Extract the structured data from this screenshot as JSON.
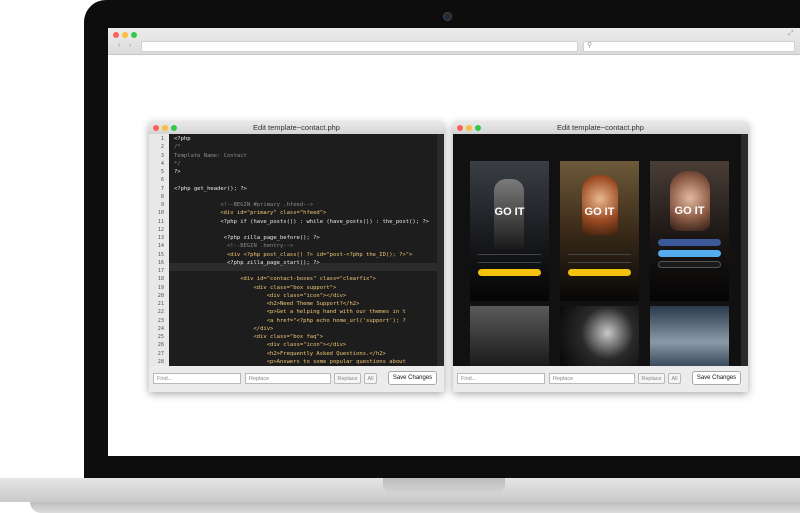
{
  "left_window": {
    "title": "Edit template~contact.php",
    "find_placeholder": "Find...",
    "replace_placeholder": "Replace",
    "replace_button": "Replace",
    "all_button": "All",
    "save_button": "Save Changes",
    "code_lines": [
      {
        "n": "1",
        "text": "<?php"
      },
      {
        "n": "2",
        "text": "/*"
      },
      {
        "n": "3",
        "text": "Template Name: Contact"
      },
      {
        "n": "4",
        "text": "*/"
      },
      {
        "n": "5",
        "text": "?>"
      },
      {
        "n": "6",
        "text": ""
      },
      {
        "n": "7",
        "text": "<?php get_header(); ?>"
      },
      {
        "n": "8",
        "text": ""
      },
      {
        "n": "9",
        "text": "              <!--BEGIN #primary .hfeed-->"
      },
      {
        "n": "10",
        "text": "              <div id=\"primary\" class=\"hfeed\">"
      },
      {
        "n": "11",
        "text": "              <?php if (have_posts()) : while (have_posts()) : the_post(); ?>"
      },
      {
        "n": "12",
        "text": ""
      },
      {
        "n": "13",
        "text": "               <?php zilla_page_before(); ?>"
      },
      {
        "n": "14",
        "text": "                <!--BEGIN .hentry-->"
      },
      {
        "n": "15",
        "text": "                <div <?php post_class() ?> id=\"post-<?php the_ID(); ?>\">"
      },
      {
        "n": "16",
        "text": "                <?php zilla_page_start(); ?>"
      },
      {
        "n": "17",
        "text": ""
      },
      {
        "n": "18",
        "text": "                    <div id=\"contact-boxes\" class=\"clearfix\">"
      },
      {
        "n": "19",
        "text": "                        <div class=\"box support\">"
      },
      {
        "n": "20",
        "text": "                            <div class=\"icon\"></div>"
      },
      {
        "n": "21",
        "text": "                            <h2>Need Theme Support?</h2>"
      },
      {
        "n": "22",
        "text": "                            <p>Get a helping hand with our themes in t"
      },
      {
        "n": "23",
        "text": "                            <a href=\"<?php echo home_url('support'); ?"
      },
      {
        "n": "24",
        "text": "                        </div>"
      },
      {
        "n": "25",
        "text": "                        <div class=\"box faq\">"
      },
      {
        "n": "26",
        "text": "                            <div class=\"icon\"></div>"
      },
      {
        "n": "27",
        "text": "                            <h2>Frequently Asked Questions.</h2>"
      },
      {
        "n": "28",
        "text": "                            <p>Answers to some popular questions about"
      }
    ]
  },
  "right_window": {
    "title": "Edit template~contact.php",
    "find_placeholder": "Find...",
    "replace_placeholder": "Replace",
    "replace_button": "Replace",
    "all_button": "All",
    "save_button": "Save Changes",
    "phone_headline": "GO IT"
  },
  "colors": {
    "editor_bg": "#1d1d1d",
    "accent_yellow": "#f4c10f",
    "facebook_blue": "#3b5998",
    "twitter_blue": "#55acee"
  }
}
